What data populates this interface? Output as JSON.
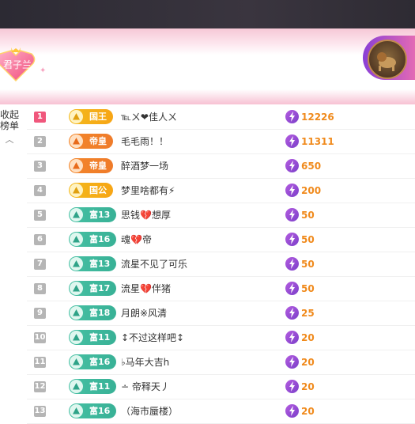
{
  "header": {
    "badge_text": "君子兰"
  },
  "sidebar": {
    "collapse_label": "收起\n榜单",
    "caret": "^"
  },
  "colors": {
    "accent": "#f08a1c",
    "rank_first": "#f0577c",
    "gold": "#f3b91c",
    "orange": "#f3862b",
    "teal": "#46c0a3",
    "bolt": "#8e46d0"
  },
  "rows": [
    {
      "rank": "1",
      "tag": "国王",
      "tag_style": "gold",
      "name": "℡ㄨ❤佳人ㄨ",
      "score": "12226"
    },
    {
      "rank": "2",
      "tag": "帝皇",
      "tag_style": "orange",
      "name": "毛毛雨！！",
      "score": "11311"
    },
    {
      "rank": "3",
      "tag": "帝皇",
      "tag_style": "orange",
      "name": "醉酒梦一场",
      "score": "650"
    },
    {
      "rank": "4",
      "tag": "国公",
      "tag_style": "gold",
      "name": "梦里啥都有⚡",
      "score": "200"
    },
    {
      "rank": "5",
      "tag": "富13",
      "tag_style": "teal",
      "name": "思钱💔想厚",
      "score": "50"
    },
    {
      "rank": "6",
      "tag": "富16",
      "tag_style": "teal",
      "name": "魂💔帝",
      "score": "50"
    },
    {
      "rank": "7",
      "tag": "富13",
      "tag_style": "teal",
      "name": "流星不见了可乐",
      "score": "50"
    },
    {
      "rank": "8",
      "tag": "富17",
      "tag_style": "teal",
      "name": "流星💔伴猪",
      "score": "50"
    },
    {
      "rank": "9",
      "tag": "富18",
      "tag_style": "teal",
      "name": "月朗※风清",
      "score": "25"
    },
    {
      "rank": "10",
      "tag": "富11",
      "tag_style": "teal",
      "name": "↕不过这样吧↕",
      "score": "20"
    },
    {
      "rank": "11",
      "tag": "富16",
      "tag_style": "teal",
      "name": "♭马年大吉h",
      "score": "20"
    },
    {
      "rank": "12",
      "tag": "富11",
      "tag_style": "teal",
      "name": "∸ 帝释天丿",
      "score": "20"
    },
    {
      "rank": "13",
      "tag": "富16",
      "tag_style": "teal",
      "name": "（海市蜃楼）",
      "score": "20"
    }
  ]
}
